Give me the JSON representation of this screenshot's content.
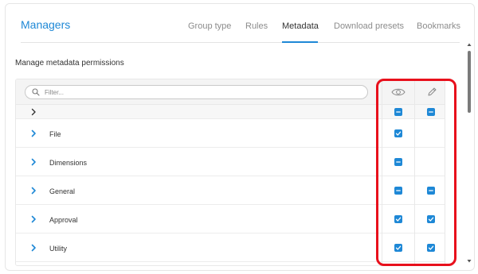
{
  "header": {
    "title": "Managers",
    "tabs": [
      {
        "label": "Group type",
        "active": false
      },
      {
        "label": "Rules",
        "active": false
      },
      {
        "label": "Metadata",
        "active": true
      },
      {
        "label": "Download presets",
        "active": false
      },
      {
        "label": "Bookmarks",
        "active": false
      }
    ]
  },
  "section": {
    "title": "Manage metadata permissions"
  },
  "filter": {
    "placeholder": "Filter...",
    "value": ""
  },
  "columns": [
    {
      "icon": "eye-icon",
      "meaning": "view"
    },
    {
      "icon": "pencil-icon",
      "meaning": "edit"
    }
  ],
  "rows": [
    {
      "label": "",
      "view": "indeterminate",
      "edit": "indeterminate",
      "expanded": false
    },
    {
      "label": "File",
      "view": "checked",
      "edit": "none",
      "expanded": false
    },
    {
      "label": "Dimensions",
      "view": "indeterminate",
      "edit": "none",
      "expanded": false
    },
    {
      "label": "General",
      "view": "indeterminate",
      "edit": "indeterminate",
      "expanded": false
    },
    {
      "label": "Approval",
      "view": "checked",
      "edit": "checked",
      "expanded": false
    },
    {
      "label": "Utility",
      "view": "checked",
      "edit": "checked",
      "expanded": false
    }
  ],
  "colors": {
    "accent": "#1e88d6",
    "highlight": "#e8101c"
  }
}
